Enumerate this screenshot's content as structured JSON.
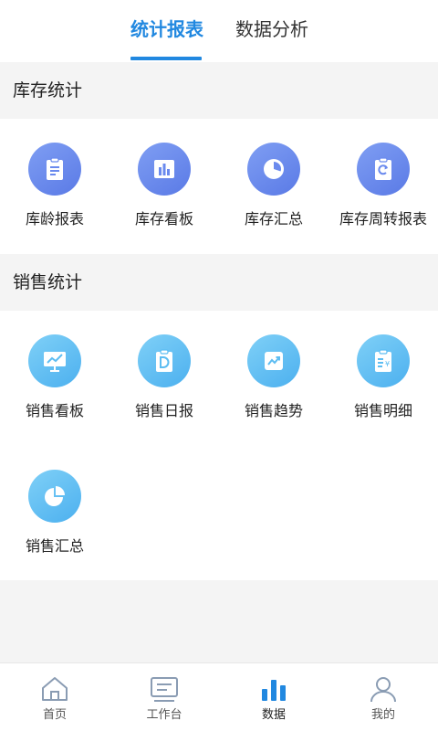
{
  "tabs": {
    "stats_report": "统计报表",
    "data_analysis": "数据分析"
  },
  "inventory": {
    "title": "库存统计",
    "items": [
      {
        "label": "库龄报表",
        "icon": "clipboard-list-icon"
      },
      {
        "label": "库存看板",
        "icon": "bar-chart-board-icon"
      },
      {
        "label": "库存汇总",
        "icon": "pie-clock-icon"
      },
      {
        "label": "库存周转报表",
        "icon": "clipboard-refresh-icon"
      }
    ]
  },
  "sales": {
    "title": "销售统计",
    "items": [
      {
        "label": "销售看板",
        "icon": "presentation-board-icon"
      },
      {
        "label": "销售日报",
        "icon": "clipboard-d-icon"
      },
      {
        "label": "销售趋势",
        "icon": "trend-up-icon"
      },
      {
        "label": "销售明细",
        "icon": "clipboard-yen-icon"
      },
      {
        "label": "销售汇总",
        "icon": "pie-chart-icon"
      }
    ]
  },
  "bottom_nav": {
    "items": [
      {
        "label": "首页",
        "icon": "home-icon"
      },
      {
        "label": "工作台",
        "icon": "workbench-icon"
      },
      {
        "label": "数据",
        "icon": "data-bar-icon",
        "active": true
      },
      {
        "label": "我的",
        "icon": "user-icon"
      }
    ]
  },
  "colors": {
    "accent": "#2188e0",
    "inventory_icon_bg": "#6a8aee",
    "sales_icon_bg": "#5dbdf2",
    "nav_inactive": "#8a9cb3"
  }
}
